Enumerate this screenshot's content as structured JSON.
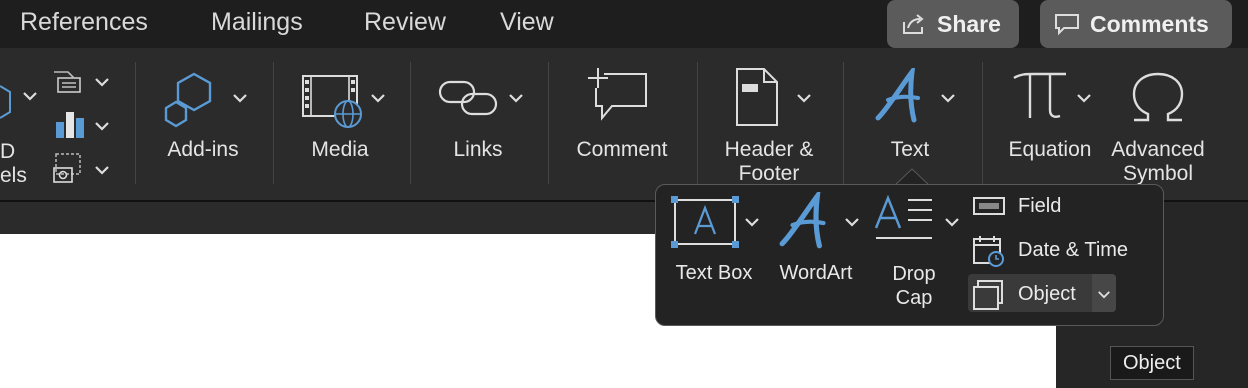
{
  "tabs": [
    {
      "label": "References"
    },
    {
      "label": "Mailings"
    },
    {
      "label": "Review"
    },
    {
      "label": "View"
    }
  ],
  "header": {
    "share_label": "Share",
    "comments_label": "Comments"
  },
  "ribbon": {
    "partial_label_top": "D",
    "partial_label_bottom": "els",
    "groups": {
      "addins": "Add-ins",
      "media": "Media",
      "links": "Links",
      "comment": "Comment",
      "header_footer_1": "Header &",
      "header_footer_2": "Footer",
      "text": "Text",
      "equation": "Equation",
      "advanced_symbol_1": "Advanced",
      "advanced_symbol_2": "Symbol"
    }
  },
  "popup": {
    "textbox": "Text Box",
    "wordart": "WordArt",
    "dropcap_1": "Drop",
    "dropcap_2": "Cap",
    "field": "Field",
    "datetime": "Date & Time",
    "object": "Object"
  },
  "tooltip": {
    "text": "Object"
  },
  "colors": {
    "accent_blue": "#5b9bd5",
    "background": "#1e1e1e",
    "ribbon": "#2b2b2b",
    "pill": "#5b5b5b"
  }
}
